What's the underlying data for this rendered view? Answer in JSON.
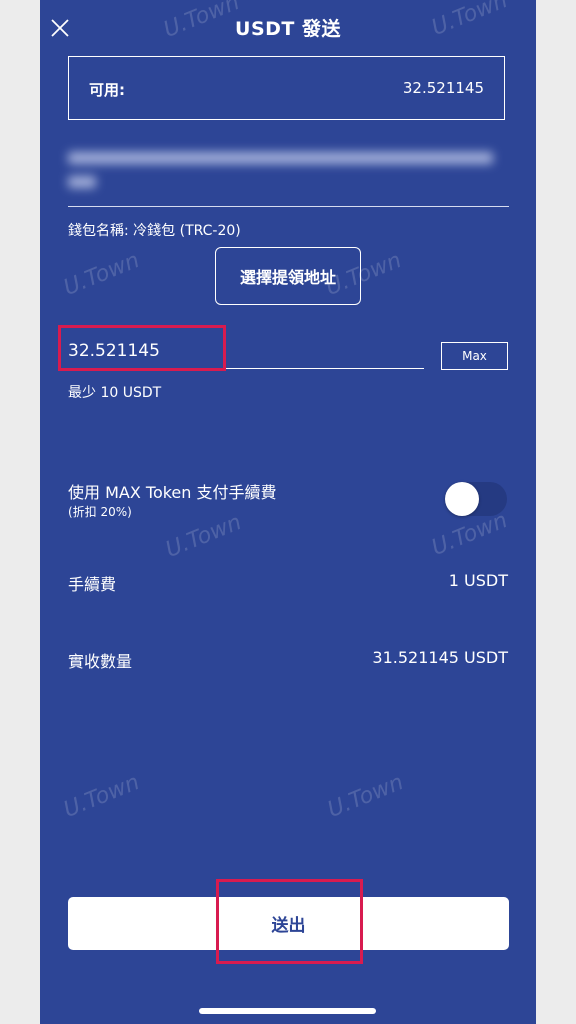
{
  "header": {
    "title": "USDT 發送",
    "close_icon": "close-icon"
  },
  "available": {
    "label": "可用:",
    "value": "32.521145"
  },
  "wallet": {
    "name": "錢包名稱: 冷錢包 (TRC-20)"
  },
  "buttons": {
    "choose_address": "選擇提領地址",
    "max": "Max",
    "send": "送出"
  },
  "amount": {
    "value": "32.521145",
    "min_text": "最少 10 USDT"
  },
  "max_token": {
    "label": "使用 MAX Token 支付手續費",
    "discount": "(折扣 20%)",
    "enabled": false
  },
  "fee": {
    "label": "手續費",
    "value": "1 USDT"
  },
  "receive": {
    "label": "實收數量",
    "value": "31.521145 USDT"
  },
  "watermark": "U.Town",
  "colors": {
    "background": "#2d4596",
    "highlight": "#d81b4f",
    "text": "#ffffff"
  }
}
